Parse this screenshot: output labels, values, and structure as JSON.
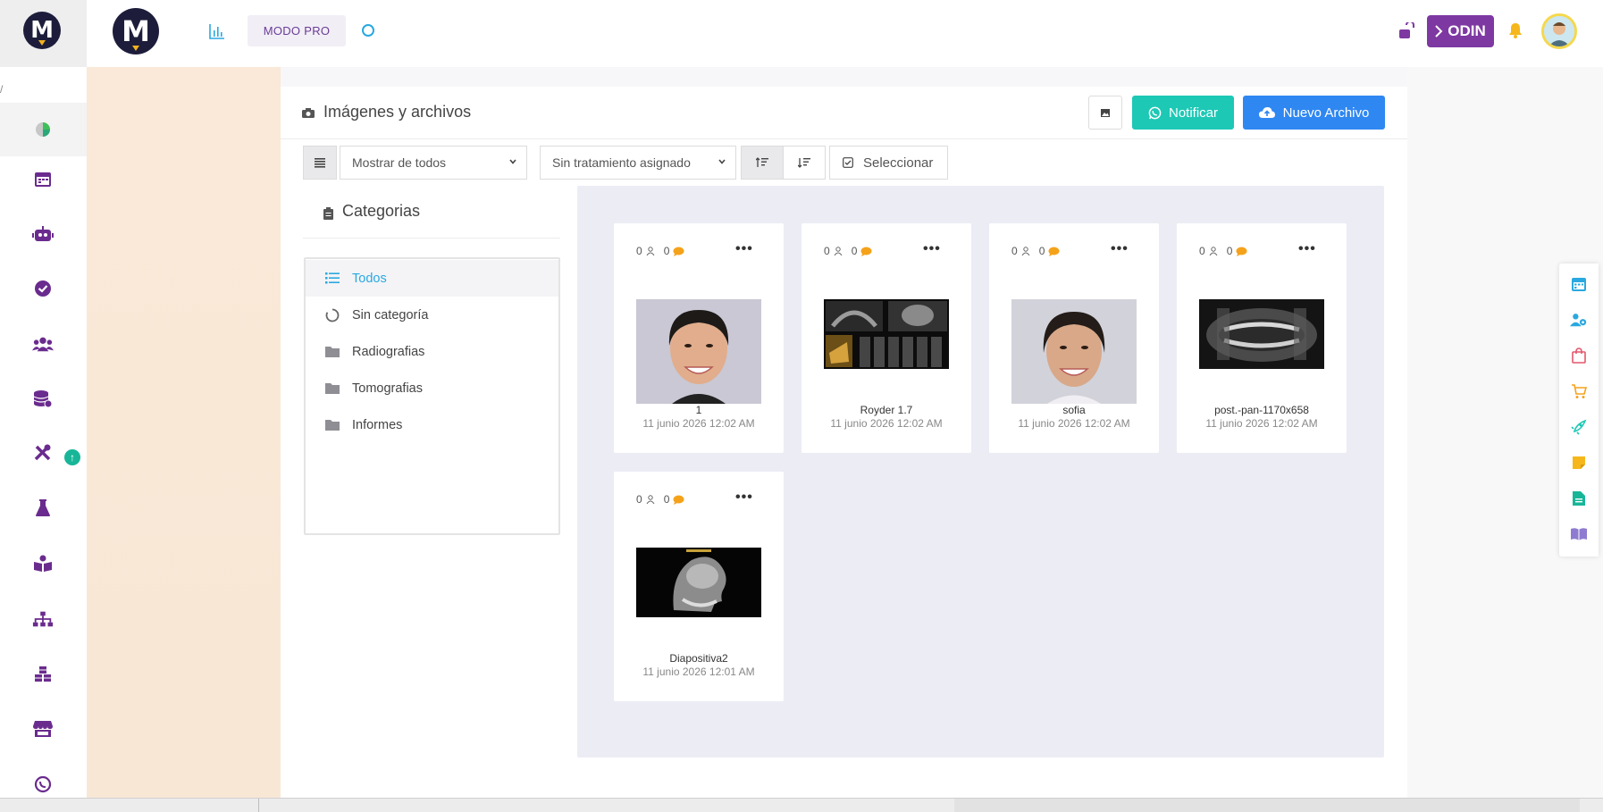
{
  "topbar": {
    "logo_letter": "M",
    "modo_pro_label": "MODO PRO",
    "odin_label": "ODIN",
    "colors": {
      "purple": "#7e38a2",
      "teal": "#1dc8b5",
      "blue": "#2f87f1",
      "accent_cyan": "#2aa8e0"
    }
  },
  "sidebar": {
    "path_hint": "/",
    "icons": [
      "pie-chart-icon",
      "calendar-icon",
      "robot-icon",
      "check-circle-icon",
      "users-icon",
      "database-icon",
      "tools-icon",
      "flask-icon",
      "book-reader-icon",
      "sitemap-icon",
      "cubes-icon",
      "store-icon",
      "whatsapp-icon"
    ],
    "badge": "upload-badge"
  },
  "main": {
    "title": "Imágenes y archivos",
    "notify_label": "Notificar",
    "new_file_label": "Nuevo Archivo",
    "filter_show": "Mostrar de todos",
    "filter_treatment": "Sin tratamiento asignado",
    "select_label": "Seleccionar"
  },
  "categories": {
    "title": "Categorias",
    "add_label": "+",
    "items": [
      {
        "label": "Todos",
        "icon": "list-icon"
      },
      {
        "label": "Sin categoría",
        "icon": "circle-icon"
      },
      {
        "label": "Radiografias",
        "icon": "folder-icon"
      },
      {
        "label": "Tomografias",
        "icon": "folder-icon"
      },
      {
        "label": "Informes",
        "icon": "folder-icon"
      }
    ]
  },
  "files": [
    {
      "name": "1",
      "date": "11 junio 2026 12:02 AM",
      "views": "0",
      "comments": "0"
    },
    {
      "name": "Royder 1.7",
      "date": "11 junio 2026 12:02 AM",
      "views": "0",
      "comments": "0"
    },
    {
      "name": "sofia",
      "date": "11 junio 2026 12:02 AM",
      "views": "0",
      "comments": "0"
    },
    {
      "name": "post.-pan-1170x658",
      "date": "11 junio 2026 12:02 AM",
      "views": "0",
      "comments": "0"
    },
    {
      "name": "Diapositiva2",
      "date": "11 junio 2026 12:01 AM",
      "views": "0",
      "comments": "0"
    }
  ],
  "card_menu_label": "•••",
  "rightbar_icons": [
    "calendar-icon",
    "users-cog-icon",
    "bag-icon",
    "cart-icon",
    "rocket-icon",
    "sticky-note-icon",
    "file-icon",
    "book-open-icon"
  ]
}
